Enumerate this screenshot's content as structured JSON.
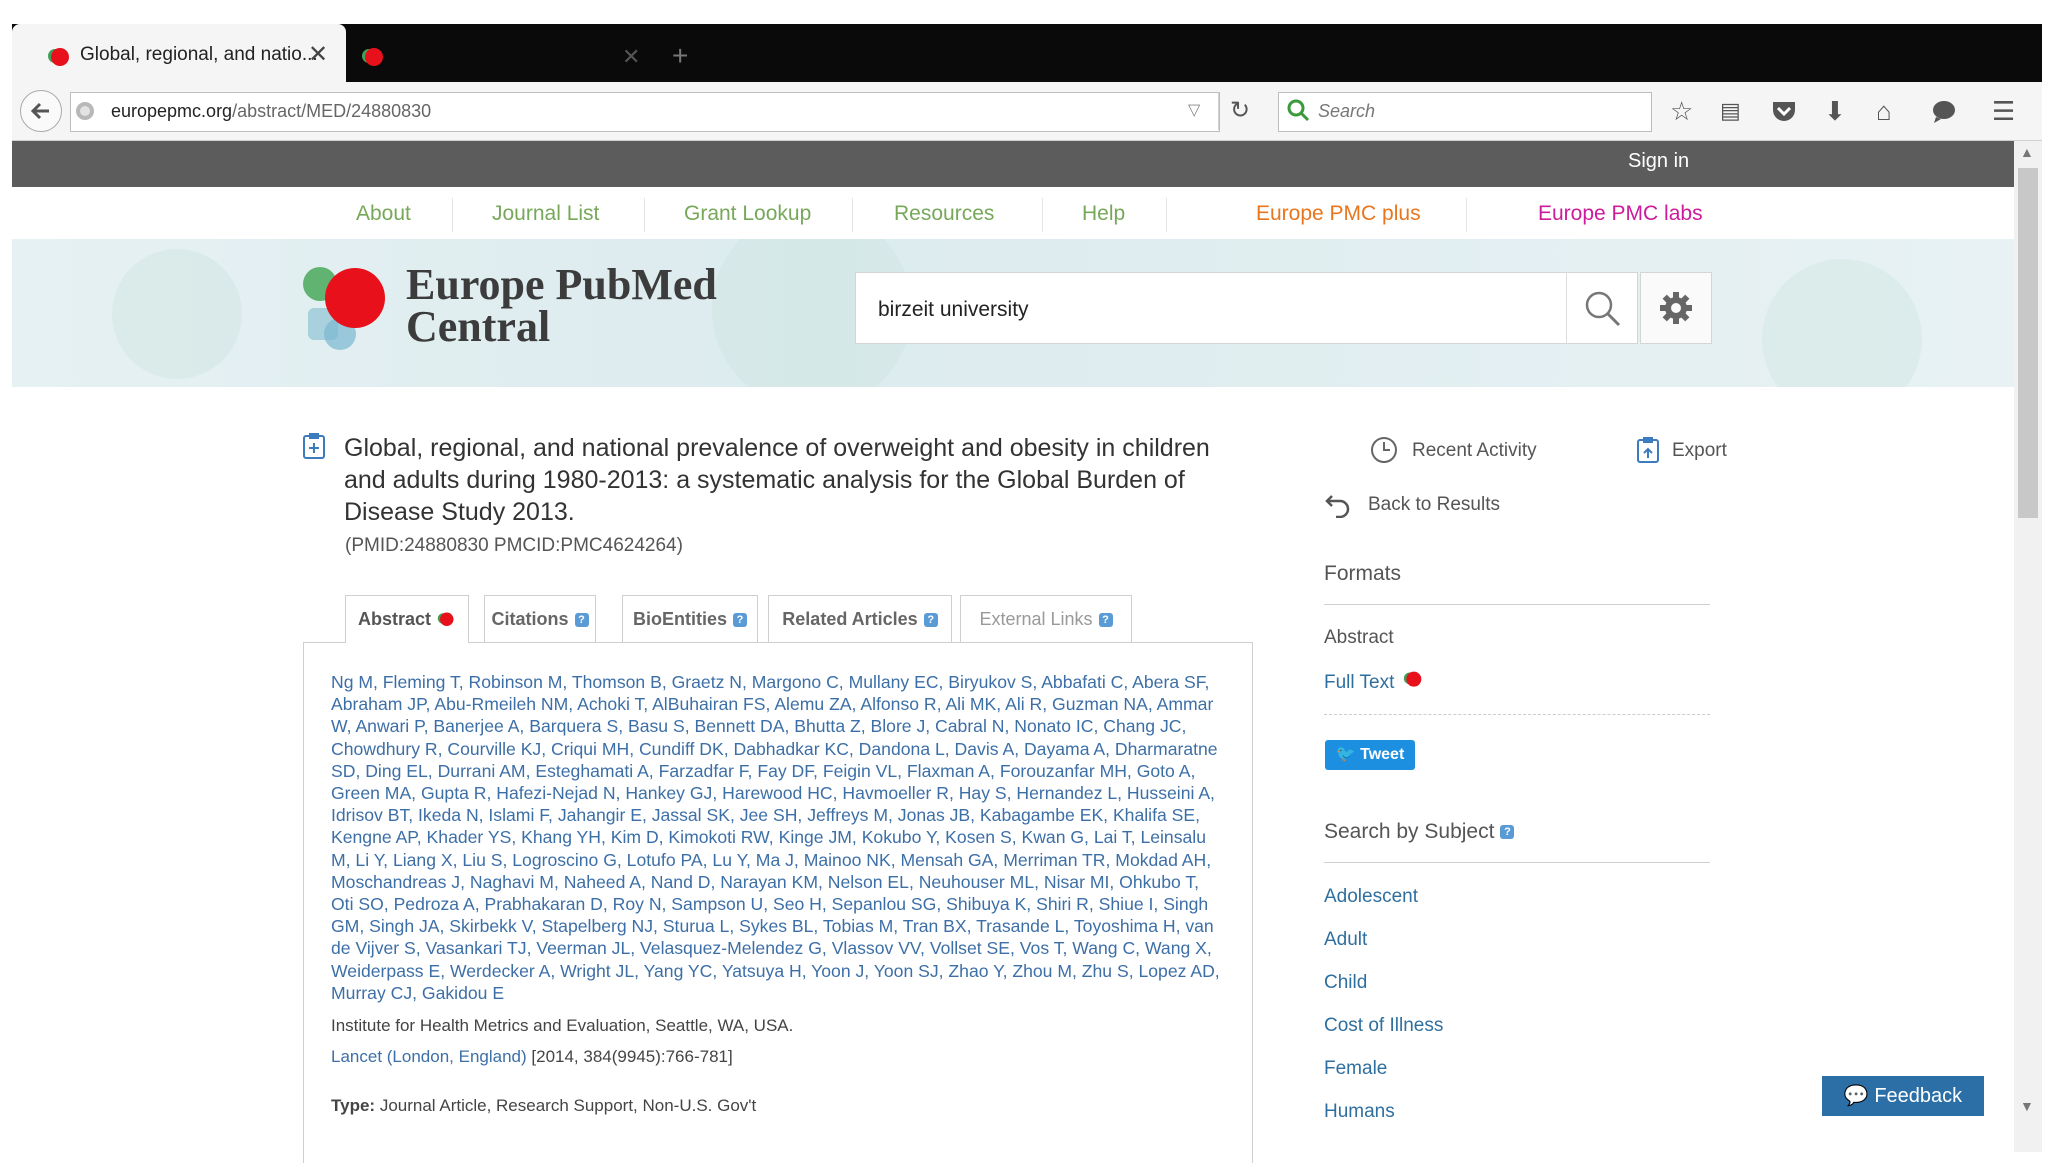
{
  "browser": {
    "tab_title": "Global, regional, and natio...",
    "url_domain": "europepmc.org",
    "url_path": "/abstract/MED/24880830",
    "search_placeholder": "Search"
  },
  "site": {
    "sign_in": "Sign in",
    "menu": [
      "About",
      "Journal List",
      "Grant Lookup",
      "Resources",
      "Help",
      "Europe PMC plus",
      "Europe PMC labs"
    ],
    "logo_line1": "Europe PubMed",
    "logo_line2": "Central",
    "search_value": "birzeit university"
  },
  "article": {
    "title": "Global, regional, and national prevalence of overweight and obesity in children and adults during 1980-2013: a systematic analysis for the Global Burden of Disease Study 2013.",
    "ids": "(PMID:24880830 PMCID:PMC4624264)",
    "tabs": [
      "Abstract",
      "Citations",
      "BioEntities",
      "Related Articles",
      "External Links"
    ],
    "authors": "Ng M, Fleming T, Robinson M, Thomson B, Graetz N, Margono C, Mullany EC, Biryukov S, Abbafati C, Abera SF, Abraham JP, Abu-Rmeileh NM, Achoki T, AlBuhairan FS, Alemu ZA, Alfonso R, Ali MK, Ali R, Guzman NA, Ammar W, Anwari P, Banerjee A, Barquera S, Basu S, Bennett DA, Bhutta Z, Blore J, Cabral N, Nonato IC, Chang JC, Chowdhury R, Courville KJ, Criqui MH, Cundiff DK, Dabhadkar KC, Dandona L, Davis A, Dayama A, Dharmaratne SD, Ding EL, Durrani AM, Esteghamati A, Farzadfar F, Fay DF, Feigin VL, Flaxman A, Forouzanfar MH, Goto A, Green MA, Gupta R, Hafezi-Nejad N, Hankey GJ, Harewood HC, Havmoeller R, Hay S, Hernandez L, Husseini A, Idrisov BT, Ikeda N, Islami F, Jahangir E, Jassal SK, Jee SH, Jeffreys M, Jonas JB, Kabagambe EK, Khalifa SE, Kengne AP, Khader YS, Khang YH, Kim D, Kimokoti RW, Kinge JM, Kokubo Y, Kosen S, Kwan G, Lai T, Leinsalu M, Li Y, Liang X, Liu S, Logroscino G, Lotufo PA, Lu Y, Ma J, Mainoo NK, Mensah GA, Merriman TR, Mokdad AH, Moschandreas J, Naghavi M, Naheed A, Nand D, Narayan KM, Nelson EL, Neuhouser ML, Nisar MI, Ohkubo T, Oti SO, Pedroza A, Prabhakaran D, Roy N, Sampson U, Seo H, Sepanlou SG, Shibuya K, Shiri R, Shiue I, Singh GM, Singh JA, Skirbekk V, Stapelberg NJ, Sturua L, Sykes BL, Tobias M, Tran BX, Trasande L, Toyoshima H, van de Vijver S, Vasankari TJ, Veerman JL, Velasquez-Melendez G, Vlassov VV, Vollset SE, Vos T, Wang C, Wang X, Weiderpass E, Werdecker A, Wright JL, Yang YC, Yatsuya H, Yoon J, Yoon SJ, Zhao Y, Zhou M, Zhu S, Lopez AD, Murray CJ, Gakidou E",
    "affiliation": "Institute for Health Metrics and Evaluation, Seattle, WA, USA.",
    "journal_name": "Lancet (London, England)",
    "journal_ref": "[2014, 384(9945):766-781]",
    "type_label": "Type:",
    "type_value": "Journal Article, Research Support, Non-U.S. Gov't"
  },
  "sidebar": {
    "recent_activity": "Recent Activity",
    "export": "Export",
    "back_to_results": "Back to Results",
    "formats_heading": "Formats",
    "format_abstract": "Abstract",
    "format_full_text": "Full Text",
    "tweet": "Tweet",
    "subject_heading": "Search by Subject",
    "subjects": [
      "Adolescent",
      "Adult",
      "Child",
      "Cost of Illness",
      "Female",
      "Humans"
    ],
    "feedback": "Feedback"
  },
  "colors": {
    "menu_green": "#77a85a",
    "menu_orange": "#e8761e",
    "menu_magenta": "#cc1b9b",
    "link_blue": "#3d6fa7",
    "logo_red": "#e8101a"
  }
}
